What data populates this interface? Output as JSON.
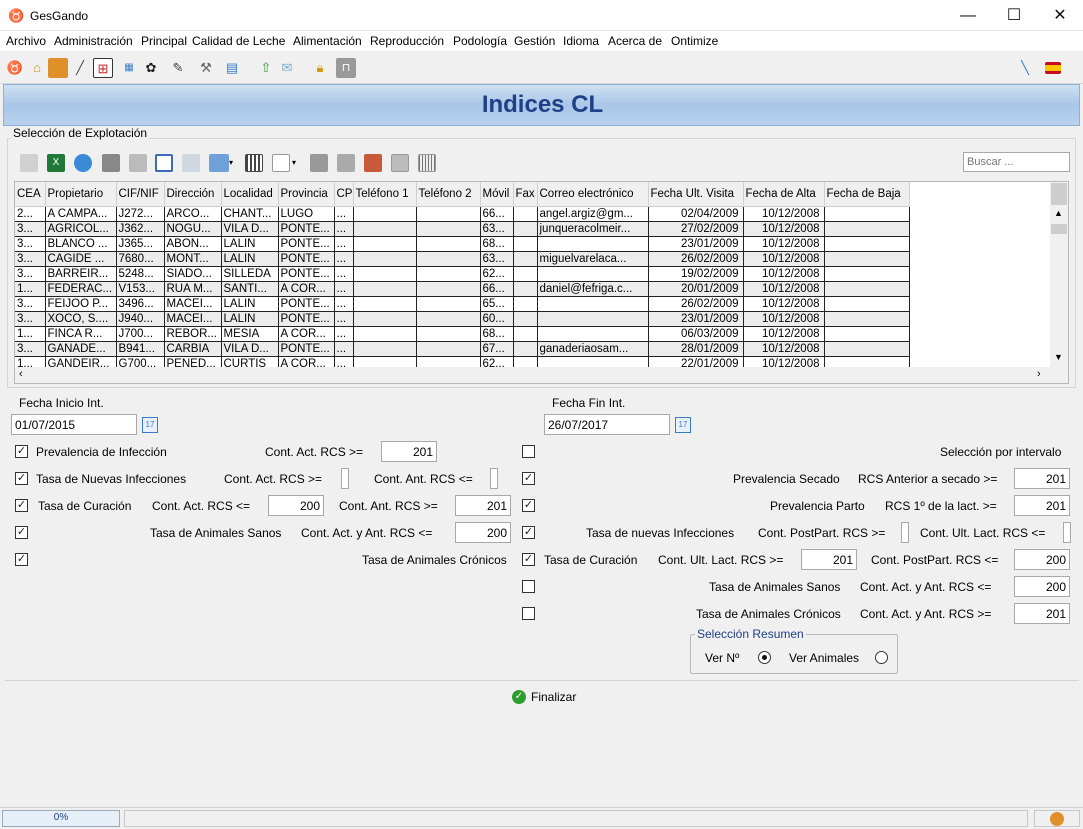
{
  "window": {
    "title": "GesGando",
    "minimize": "—",
    "maximize": "☐",
    "close": "✕"
  },
  "menu": [
    "Archivo",
    "Administración",
    "Principal",
    "Calidad de Leche",
    "Alimentación",
    "Reproducción",
    "Podología",
    "Gestión",
    "Idioma",
    "Acerca de",
    "Ontimize"
  ],
  "header": {
    "title": "Indices CL"
  },
  "explotacion": {
    "group_label": "Selección de Explotación",
    "search_placeholder": "Buscar ...",
    "columns": [
      "CEA",
      "Propietario",
      "CIF/NIF",
      "Dirección",
      "Localidad",
      "Provincia",
      "CP",
      "Teléfono 1",
      "Teléfono 2",
      "Móvil",
      "Fax",
      "Correo electrónico",
      "Fecha Ult. Visita",
      "Fecha de Alta",
      "Fecha de Baja"
    ],
    "rows": [
      [
        "2...",
        "A CAMPA...",
        "J272...",
        "ARCO...",
        "CHANT...",
        "LUGO",
        "...",
        "",
        "",
        "66...",
        "",
        "angel.argiz@gm...",
        "02/04/2009",
        "10/12/2008",
        ""
      ],
      [
        "3...",
        "AGRICOL...",
        "J362...",
        "NOGU...",
        "VILA D...",
        "PONTE...",
        "...",
        "",
        "",
        "63...",
        "",
        "junqueracolmeir...",
        "27/02/2009",
        "10/12/2008",
        ""
      ],
      [
        "3...",
        "BLANCO ...",
        "J365...",
        "ABON...",
        "LALIN",
        "PONTE...",
        "...",
        "",
        "",
        "68...",
        "",
        "",
        "23/01/2009",
        "10/12/2008",
        ""
      ],
      [
        "3...",
        "CAGIDE ...",
        "7680...",
        "MONT...",
        "LALIN",
        "PONTE...",
        "...",
        "",
        "",
        "63...",
        "",
        "miguelvarelaca...",
        "26/02/2009",
        "10/12/2008",
        ""
      ],
      [
        "3...",
        "BARREIR...",
        "5248...",
        "SIADO...",
        "SILLEDA",
        "PONTE...",
        "...",
        "",
        "",
        "62...",
        "",
        "",
        "19/02/2009",
        "10/12/2008",
        ""
      ],
      [
        "1...",
        "FEDERAC...",
        "V153...",
        "RUA M...",
        "SANTI...",
        "A COR...",
        "...",
        "",
        "",
        "66...",
        "",
        "daniel@fefriga.c...",
        "20/01/2009",
        "10/12/2008",
        ""
      ],
      [
        "3...",
        "FEIJOO P...",
        "3496...",
        "MACEI...",
        "LALIN",
        "PONTE...",
        "...",
        "",
        "",
        "65...",
        "",
        "",
        "26/02/2009",
        "10/12/2008",
        ""
      ],
      [
        "3...",
        "XOCO, S....",
        "J940...",
        "MACEI...",
        "LALIN",
        "PONTE...",
        "...",
        "",
        "",
        "60...",
        "",
        "",
        "23/01/2009",
        "10/12/2008",
        ""
      ],
      [
        "1...",
        "FINCA R...",
        "J700...",
        "REBOR...",
        "MESIA",
        "A COR...",
        "...",
        "",
        "",
        "68...",
        "",
        "",
        "06/03/2009",
        "10/12/2008",
        ""
      ],
      [
        "3...",
        "GANADE...",
        "B941...",
        "CARBIA",
        "VILA D...",
        "PONTE...",
        "...",
        "",
        "",
        "67...",
        "",
        "ganaderiaosam...",
        "28/01/2009",
        "10/12/2008",
        ""
      ],
      [
        "1...",
        "GANDEIR...",
        "G700...",
        "PENED...",
        "CURTIS",
        "A COR...",
        "...",
        "",
        "",
        "62...",
        "",
        "",
        "22/01/2009",
        "10/12/2008",
        ""
      ]
    ]
  },
  "fecha_inicio": {
    "label": "Fecha Inicio Int.",
    "value": "01/07/2015"
  },
  "fecha_fin": {
    "label": "Fecha Fin Int.",
    "value": "26/07/2017"
  },
  "left": {
    "prevalencia": {
      "label": "Prevalencia de Infección",
      "checked": true,
      "f1_label": "Cont. Act. RCS >=",
      "f1_value": "201"
    },
    "nuevas": {
      "label": "Tasa de Nuevas Infecciones",
      "checked": true,
      "f1_label": "Cont. Act. RCS >=",
      "f2_label": "Cont. Ant. RCS <="
    },
    "curacion": {
      "label": "Tasa de Curación",
      "checked": true,
      "f1_label": "Cont. Act. RCS <=",
      "f1_value": "200",
      "f2_label": "Cont. Ant. RCS >=",
      "f2_value": "201"
    },
    "sanos": {
      "label": "Tasa de Animales Sanos",
      "checked": true,
      "f1_label": "Cont. Act. y Ant. RCS <=",
      "f1_value": "200"
    },
    "cronicos": {
      "label": "Tasa de Animales Crónicos",
      "checked": true
    }
  },
  "right": {
    "intervalo": {
      "label": "Selección por intervalo",
      "checked": false
    },
    "secado": {
      "label": "Prevalencia Secado",
      "checked": true,
      "f1_label": "RCS Anterior a secado >=",
      "f1_value": "201"
    },
    "parto": {
      "label": "Prevalencia Parto",
      "checked": true,
      "f1_label": "RCS 1º de la lact. >=",
      "f1_value": "201"
    },
    "nuevas": {
      "label": "Tasa de nuevas Infecciones",
      "checked": true,
      "f1_label": "Cont. PostPart. RCS >=",
      "f2_label": "Cont. Ult. Lact. RCS <="
    },
    "curacion": {
      "label": "Tasa de Curación",
      "checked": true,
      "f1_label": "Cont. Ult. Lact. RCS >=",
      "f1_value": "201",
      "f2_label": "Cont. PostPart. RCS <=",
      "f2_value": "200"
    },
    "sanos": {
      "label": "Tasa de Animales Sanos",
      "checked": false,
      "f1_label": "Cont. Act. y Ant. RCS <=",
      "f1_value": "200"
    },
    "cronicos": {
      "label": "Tasa de Animales Crónicos",
      "checked": false,
      "f1_label": "Cont. Act. y Ant. RCS >=",
      "f1_value": "201"
    }
  },
  "resumen": {
    "legend": "Selección Resumen",
    "opt1": "Ver Nº",
    "opt2": "Ver Animales",
    "selected": "opt1"
  },
  "finalizar": "Finalizar",
  "status": {
    "progress_text": "0%",
    "progress": 0
  },
  "colors": {
    "accent": "#1f3f88",
    "header_bg": "#a9c6e8",
    "ok_green": "#2e9e2e"
  }
}
